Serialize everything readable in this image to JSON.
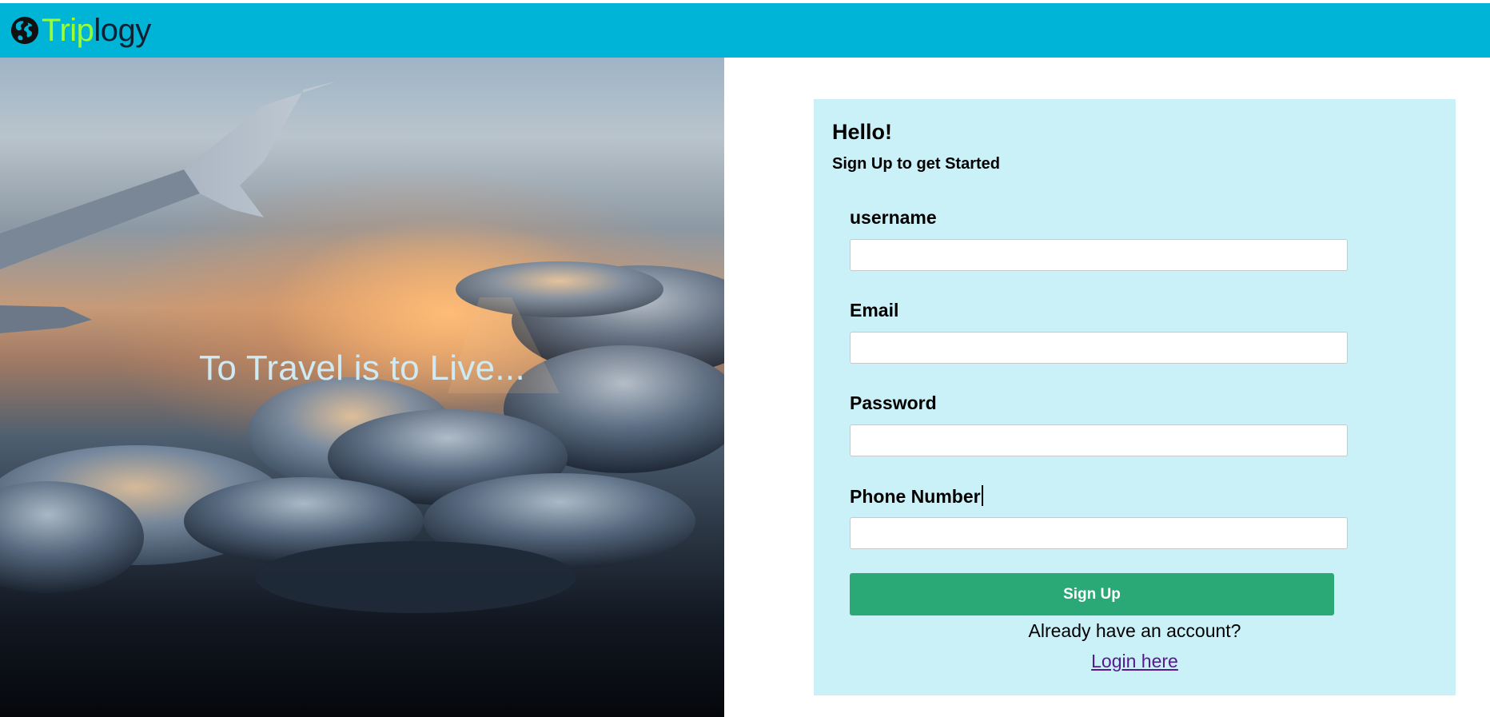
{
  "header": {
    "logo_part1": "Trip",
    "logo_part2": "logy",
    "logo_icon": "globe-icon",
    "background_color": "#00b4d8",
    "logo_color_part1": "#9cff2e"
  },
  "hero": {
    "tagline": "To Travel is to Live..."
  },
  "form": {
    "greeting": "Hello!",
    "subtitle": "Sign Up to get Started",
    "fields": [
      {
        "label": "username",
        "value": "",
        "placeholder": ""
      },
      {
        "label": "Email",
        "value": "",
        "placeholder": ""
      },
      {
        "label": "Password",
        "value": "",
        "placeholder": ""
      },
      {
        "label": "Phone Number",
        "value": "",
        "placeholder": ""
      }
    ],
    "submit_label": "Sign Up",
    "submit_color": "#2aa876",
    "already_text": "Already have an account?",
    "login_link": "Login here",
    "card_color": "#caf0f8"
  }
}
